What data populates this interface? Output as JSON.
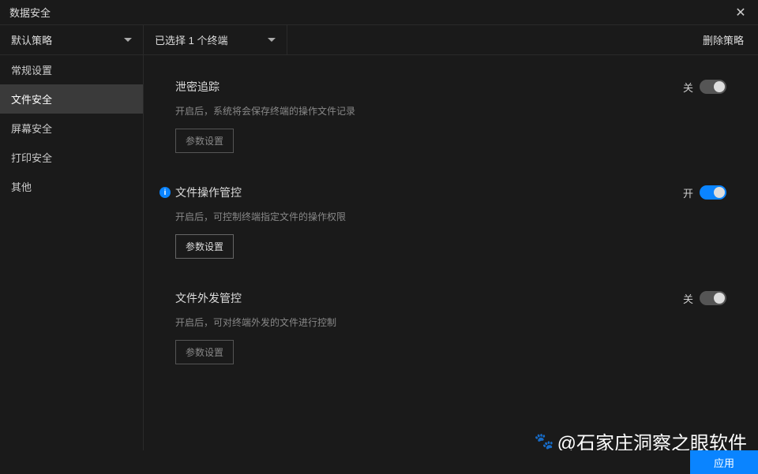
{
  "titlebar": {
    "title": "数据安全"
  },
  "toolbar": {
    "policy_dropdown": "默认策略",
    "terminal_dropdown": "已选择 1 个终端",
    "delete_policy": "删除策略"
  },
  "sidebar": {
    "items": [
      {
        "label": "常规设置",
        "active": false
      },
      {
        "label": "文件安全",
        "active": true
      },
      {
        "label": "屏幕安全",
        "active": false
      },
      {
        "label": "打印安全",
        "active": false
      },
      {
        "label": "其他",
        "active": false
      }
    ]
  },
  "settings": [
    {
      "title": "泄密追踪",
      "desc": "开启后，系统将会保存终端的操作文件记录",
      "param_label": "参数设置",
      "toggle_label": "关",
      "toggle_on": false,
      "has_info": false,
      "param_enabled": false
    },
    {
      "title": "文件操作管控",
      "desc": "开启后，可控制终端指定文件的操作权限",
      "param_label": "参数设置",
      "toggle_label": "开",
      "toggle_on": true,
      "has_info": true,
      "param_enabled": true
    },
    {
      "title": "文件外发管控",
      "desc": "开启后，可对终端外发的文件进行控制",
      "param_label": "参数设置",
      "toggle_label": "关",
      "toggle_on": false,
      "has_info": false,
      "param_enabled": false
    }
  ],
  "bottom": {
    "apply": "应用"
  },
  "watermark": {
    "text": "@石家庄洞察之眼软件"
  }
}
